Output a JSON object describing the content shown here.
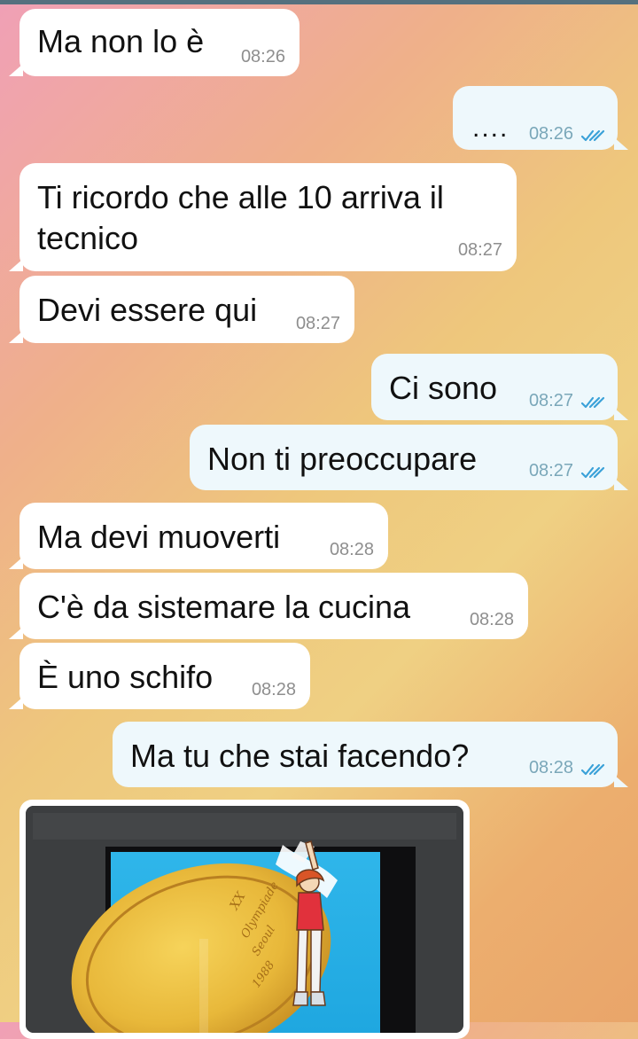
{
  "colors": {
    "incoming_bubble": "#ffffff",
    "outgoing_bubble": "#eef8fc",
    "read_check": "#3aa1d8",
    "timestamp": "#8e8e8e"
  },
  "messages": [
    {
      "id": "m1",
      "direction": "in",
      "text": "Ma non lo è",
      "time": "08:26"
    },
    {
      "id": "m2",
      "direction": "out",
      "text": "....",
      "time": "08:26",
      "status": "read"
    },
    {
      "id": "m3",
      "direction": "in",
      "text": "Ti ricordo che alle 10 arriva il tecnico",
      "time": "08:27"
    },
    {
      "id": "m4",
      "direction": "in",
      "text": "Devi essere qui",
      "time": "08:27"
    },
    {
      "id": "m5",
      "direction": "out",
      "text": "Ci sono",
      "time": "08:27",
      "status": "read"
    },
    {
      "id": "m6",
      "direction": "out",
      "text": "Non ti preoccupare",
      "time": "08:27",
      "status": "read"
    },
    {
      "id": "m7",
      "direction": "in",
      "text": "Ma devi muoverti",
      "time": "08:28"
    },
    {
      "id": "m8",
      "direction": "in",
      "text": "C'è da sistemare la cucina",
      "time": "08:28"
    },
    {
      "id": "m9",
      "direction": "in",
      "text": "È uno schifo",
      "time": "08:28"
    },
    {
      "id": "m10",
      "direction": "out",
      "text": "Ma tu che stai facendo?",
      "time": "08:28",
      "status": "read"
    }
  ],
  "photo_message": {
    "direction": "in",
    "type": "photo",
    "medal_text": [
      "XX",
      "Olympiade",
      "Seoul",
      "1988"
    ]
  }
}
